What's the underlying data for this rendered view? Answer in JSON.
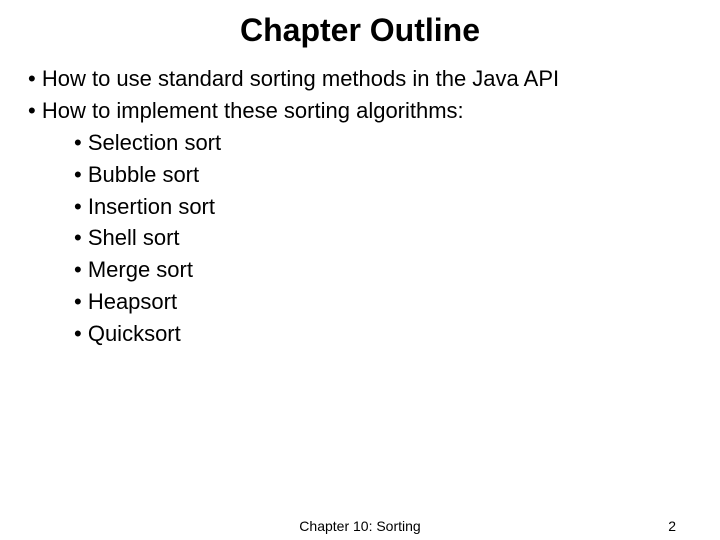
{
  "title": "Chapter Outline",
  "bullets": [
    {
      "text": "How to use standard sorting methods in the Java API"
    },
    {
      "text": "How to implement these sorting algorithms:",
      "children": [
        "Selection sort",
        "Bubble sort",
        "Insertion sort",
        "Shell sort",
        "Merge sort",
        "Heapsort",
        "Quicksort"
      ]
    }
  ],
  "footer": {
    "center": "Chapter 10: Sorting",
    "pageNumber": "2"
  }
}
